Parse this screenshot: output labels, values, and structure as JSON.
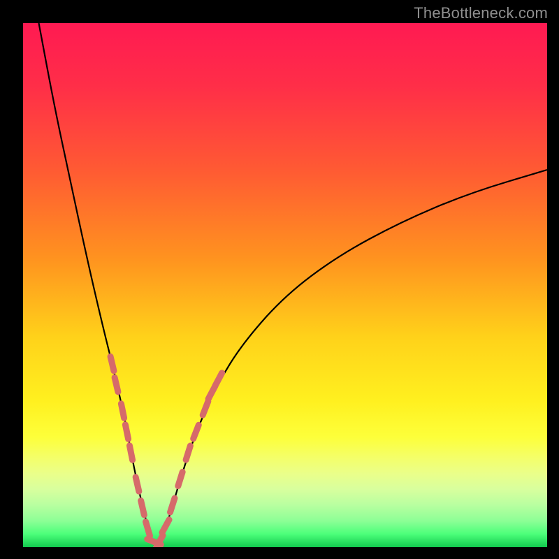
{
  "watermark": {
    "text": "TheBottleneck.com"
  },
  "colors": {
    "black": "#000000",
    "curve": "#000000",
    "marker": "#d66a6a",
    "gradient_stops": [
      {
        "offset": 0.0,
        "color": "#ff1a52"
      },
      {
        "offset": 0.12,
        "color": "#ff2e48"
      },
      {
        "offset": 0.28,
        "color": "#ff5a33"
      },
      {
        "offset": 0.45,
        "color": "#ff931f"
      },
      {
        "offset": 0.6,
        "color": "#ffd21a"
      },
      {
        "offset": 0.72,
        "color": "#fff01f"
      },
      {
        "offset": 0.79,
        "color": "#fdff3a"
      },
      {
        "offset": 0.83,
        "color": "#f4ff6a"
      },
      {
        "offset": 0.86,
        "color": "#eaff8a"
      },
      {
        "offset": 0.89,
        "color": "#d8ff9e"
      },
      {
        "offset": 0.92,
        "color": "#b8ffa0"
      },
      {
        "offset": 0.95,
        "color": "#8cff96"
      },
      {
        "offset": 0.975,
        "color": "#4cff7a"
      },
      {
        "offset": 1.0,
        "color": "#12c94e"
      }
    ]
  },
  "chart_data": {
    "type": "line",
    "title": "",
    "xlabel": "",
    "ylabel": "",
    "xlim": [
      0,
      100
    ],
    "ylim": [
      0,
      100
    ],
    "notes": "V-shaped bottleneck curve. Apex near x≈25, y≈0. Left branch steep to (≈3,100); right branch rises to (100,≈72). Salmon markers highlight segments of the curve roughly between y≈7 and y≈33 on both branches and along the trough.",
    "series": [
      {
        "name": "curve",
        "x": [
          3.0,
          6.0,
          9.0,
          12.0,
          15.0,
          17.5,
          19.5,
          21.0,
          22.5,
          24.0,
          25.0,
          26.5,
          28.0,
          30.0,
          33.0,
          37.0,
          42.0,
          50.0,
          60.0,
          72.0,
          85.0,
          100.0
        ],
        "y": [
          100.0,
          84.0,
          70.0,
          56.0,
          43.0,
          33.0,
          24.0,
          16.0,
          9.0,
          3.0,
          0.5,
          2.0,
          6.0,
          13.0,
          22.0,
          31.0,
          39.0,
          48.0,
          55.5,
          62.0,
          67.5,
          72.0
        ]
      }
    ],
    "markers": [
      {
        "x": 17.0,
        "y": 35.0
      },
      {
        "x": 17.8,
        "y": 31.0
      },
      {
        "x": 19.0,
        "y": 26.0
      },
      {
        "x": 19.8,
        "y": 22.0
      },
      {
        "x": 20.6,
        "y": 18.0
      },
      {
        "x": 21.8,
        "y": 12.0
      },
      {
        "x": 22.8,
        "y": 7.5
      },
      {
        "x": 23.8,
        "y": 3.5
      },
      {
        "x": 25.0,
        "y": 1.0
      },
      {
        "x": 26.0,
        "y": 1.0
      },
      {
        "x": 27.2,
        "y": 4.0
      },
      {
        "x": 28.5,
        "y": 8.0
      },
      {
        "x": 30.0,
        "y": 13.0
      },
      {
        "x": 31.5,
        "y": 18.0
      },
      {
        "x": 33.0,
        "y": 22.0
      },
      {
        "x": 34.8,
        "y": 26.5
      },
      {
        "x": 36.0,
        "y": 29.5
      },
      {
        "x": 37.3,
        "y": 32.0
      }
    ],
    "marker_radius": 1.4,
    "grid": false,
    "legend": false
  }
}
